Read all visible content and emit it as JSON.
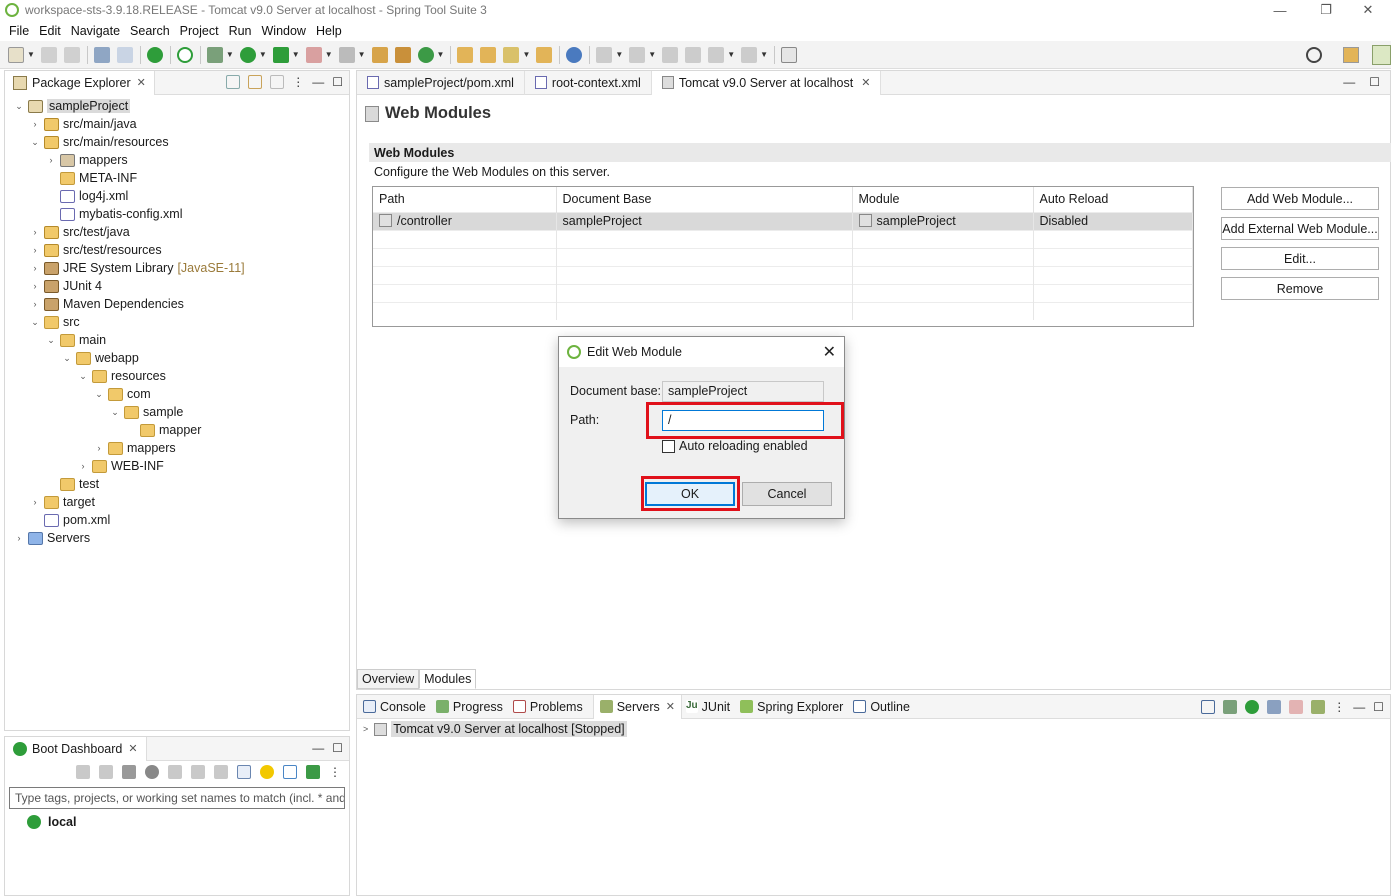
{
  "window": {
    "title": "workspace-sts-3.9.18.RELEASE - Tomcat v9.0 Server at localhost - Spring Tool Suite 3",
    "controls": [
      "—",
      "❐",
      "✕"
    ]
  },
  "menu": [
    "File",
    "Edit",
    "Navigate",
    "Search",
    "Project",
    "Run",
    "Window",
    "Help"
  ],
  "package_explorer": {
    "tab_label": "Package Explorer",
    "tree": [
      {
        "label": "sampleProject",
        "indent": 0,
        "chev": "v",
        "icon": "project",
        "selected": true
      },
      {
        "label": "src/main/java",
        "indent": 1,
        "chev": ">",
        "icon": "pkgfolder"
      },
      {
        "label": "src/main/resources",
        "indent": 1,
        "chev": "v",
        "icon": "pkgfolder"
      },
      {
        "label": "mappers",
        "indent": 2,
        "chev": ">",
        "icon": "pkg"
      },
      {
        "label": "META-INF",
        "indent": 2,
        "chev": "",
        "icon": "folder"
      },
      {
        "label": "log4j.xml",
        "indent": 2,
        "chev": "",
        "icon": "xml"
      },
      {
        "label": "mybatis-config.xml",
        "indent": 2,
        "chev": "",
        "icon": "xml"
      },
      {
        "label": "src/test/java",
        "indent": 1,
        "chev": ">",
        "icon": "pkgfolder"
      },
      {
        "label": "src/test/resources",
        "indent": 1,
        "chev": ">",
        "icon": "pkgfolder"
      },
      {
        "label": "JRE System Library",
        "suffix": "[JavaSE-11]",
        "indent": 1,
        "chev": ">",
        "icon": "lib"
      },
      {
        "label": "JUnit 4",
        "indent": 1,
        "chev": ">",
        "icon": "lib"
      },
      {
        "label": "Maven Dependencies",
        "indent": 1,
        "chev": ">",
        "icon": "lib"
      },
      {
        "label": "src",
        "indent": 1,
        "chev": "v",
        "icon": "folder"
      },
      {
        "label": "main",
        "indent": 2,
        "chev": "v",
        "icon": "folder"
      },
      {
        "label": "webapp",
        "indent": 3,
        "chev": "v",
        "icon": "folder"
      },
      {
        "label": "resources",
        "indent": 4,
        "chev": "v",
        "icon": "folder"
      },
      {
        "label": "com",
        "indent": 5,
        "chev": "v",
        "icon": "folder"
      },
      {
        "label": "sample",
        "indent": 6,
        "chev": "v",
        "icon": "folder"
      },
      {
        "label": "mapper",
        "indent": 7,
        "chev": "",
        "icon": "folder"
      },
      {
        "label": "mappers",
        "indent": 5,
        "chev": ">",
        "icon": "folder"
      },
      {
        "label": "WEB-INF",
        "indent": 4,
        "chev": ">",
        "icon": "folder"
      },
      {
        "label": "test",
        "indent": 2,
        "chev": "",
        "icon": "folder"
      },
      {
        "label": "target",
        "indent": 1,
        "chev": ">",
        "icon": "folder"
      },
      {
        "label": "pom.xml",
        "indent": 1,
        "chev": "",
        "icon": "xml"
      },
      {
        "label": "Servers",
        "indent": 0,
        "chev": ">",
        "icon": "servers"
      }
    ]
  },
  "boot_dashboard": {
    "tab_label": "Boot Dashboard",
    "filter_placeholder": "Type tags, projects, or working set names to match (incl. * and",
    "local_label": "local"
  },
  "editor": {
    "tabs": [
      {
        "label": "sampleProject/pom.xml",
        "active": false
      },
      {
        "label": "root-context.xml",
        "active": false
      },
      {
        "label": "Tomcat v9.0 Server at localhost",
        "active": true
      }
    ],
    "heading": "Web Modules",
    "section_title": "Web Modules",
    "section_desc": "Configure the Web Modules on this server.",
    "table": {
      "columns": [
        "Path",
        "Document Base",
        "Module",
        "Auto Reload"
      ],
      "rows": [
        [
          "/controller",
          "sampleProject",
          "sampleProject",
          "Disabled"
        ]
      ]
    },
    "buttons": {
      "add_web_module": "Add Web Module...",
      "add_external": "Add External Web Module...",
      "edit": "Edit...",
      "remove": "Remove"
    },
    "bottom_tabs": [
      "Overview",
      "Modules"
    ],
    "active_bottom_tab": "Modules"
  },
  "console": {
    "tabs": [
      "Console",
      "Progress",
      "Problems",
      "Servers",
      "JUnit",
      "Spring Explorer",
      "Outline"
    ],
    "active_tab": "Servers",
    "server_entry": "Tomcat v9.0 Server at localhost  [Stopped]"
  },
  "dialog": {
    "title": "Edit Web Module",
    "docbase_label": "Document base:",
    "docbase_value": "sampleProject",
    "path_label": "Path:",
    "path_value": "/",
    "auto_reload_label": "Auto reloading enabled",
    "auto_reload_checked": false,
    "ok_label": "OK",
    "cancel_label": "Cancel"
  },
  "colors": {
    "highlight_red": "#e0101a",
    "focus_blue": "#0078d7",
    "spring_green": "#6db33f"
  }
}
